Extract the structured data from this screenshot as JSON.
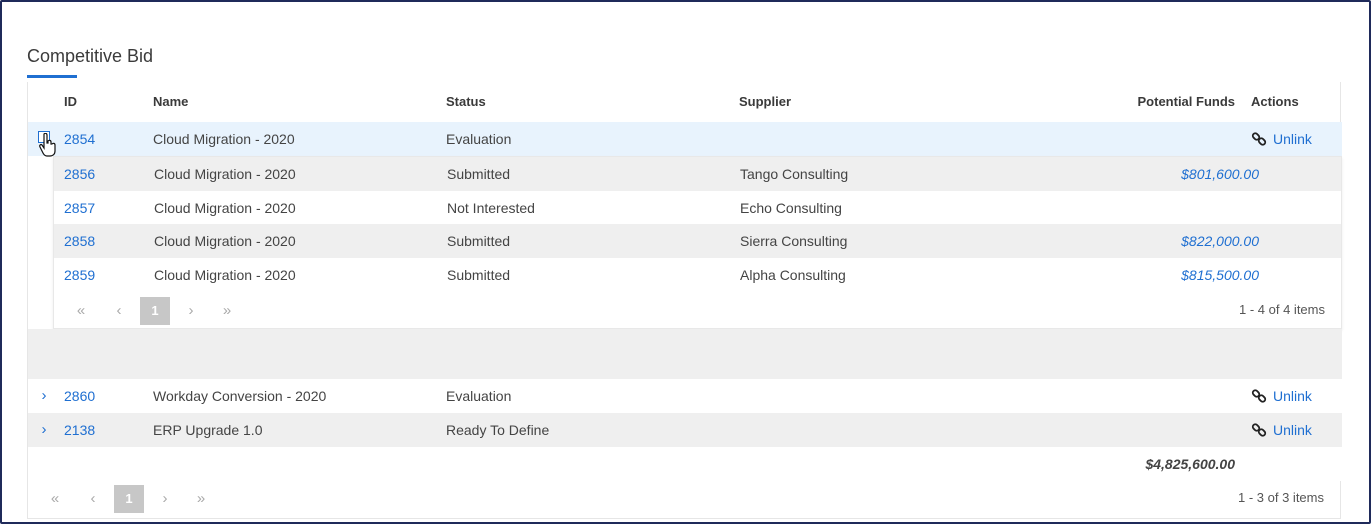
{
  "section": {
    "title": "Competitive Bid"
  },
  "columns": {
    "id": "ID",
    "name": "Name",
    "status": "Status",
    "supplier": "Supplier",
    "funds": "Potential Funds",
    "actions": "Actions"
  },
  "rows": [
    {
      "id": "2854",
      "name": "Cloud Migration - 2020",
      "status": "Evaluation",
      "supplier": "",
      "funds": "",
      "action": "Unlink",
      "expanded": true
    },
    {
      "id": "2860",
      "name": "Workday Conversion - 2020",
      "status": "Evaluation",
      "supplier": "",
      "funds": "",
      "action": "Unlink",
      "expanded": false
    },
    {
      "id": "2138",
      "name": "ERP Upgrade 1.0",
      "status": "Ready To Define",
      "supplier": "",
      "funds": "",
      "action": "Unlink",
      "expanded": false
    }
  ],
  "detail_rows": [
    {
      "id": "2856",
      "name": "Cloud Migration - 2020",
      "status": "Submitted",
      "supplier": "Tango Consulting",
      "funds": "$801,600.00"
    },
    {
      "id": "2857",
      "name": "Cloud Migration - 2020",
      "status": "Not Interested",
      "supplier": "Echo Consulting",
      "funds": ""
    },
    {
      "id": "2858",
      "name": "Cloud Migration - 2020",
      "status": "Submitted",
      "supplier": "Sierra Consulting",
      "funds": "$822,000.00"
    },
    {
      "id": "2859",
      "name": "Cloud Migration - 2020",
      "status": "Submitted",
      "supplier": "Alpha Consulting",
      "funds": "$815,500.00"
    }
  ],
  "detail_pager": {
    "first": "«",
    "prev": "‹",
    "page": "1",
    "next": "›",
    "last": "»",
    "info": "1 - 4 of 4 items"
  },
  "total": {
    "funds": "$4,825,600.00"
  },
  "main_pager": {
    "first": "«",
    "prev": "‹",
    "page": "1",
    "next": "›",
    "last": "»",
    "info": "1 - 3 of 3 items"
  },
  "icons": {
    "expand": "chevron-right-icon",
    "collapse": "collapse-icon",
    "unlink": "link-icon"
  },
  "colors": {
    "accent": "#1f6fd1",
    "stripe": "#efefef",
    "selected": "#e8f3fd"
  }
}
